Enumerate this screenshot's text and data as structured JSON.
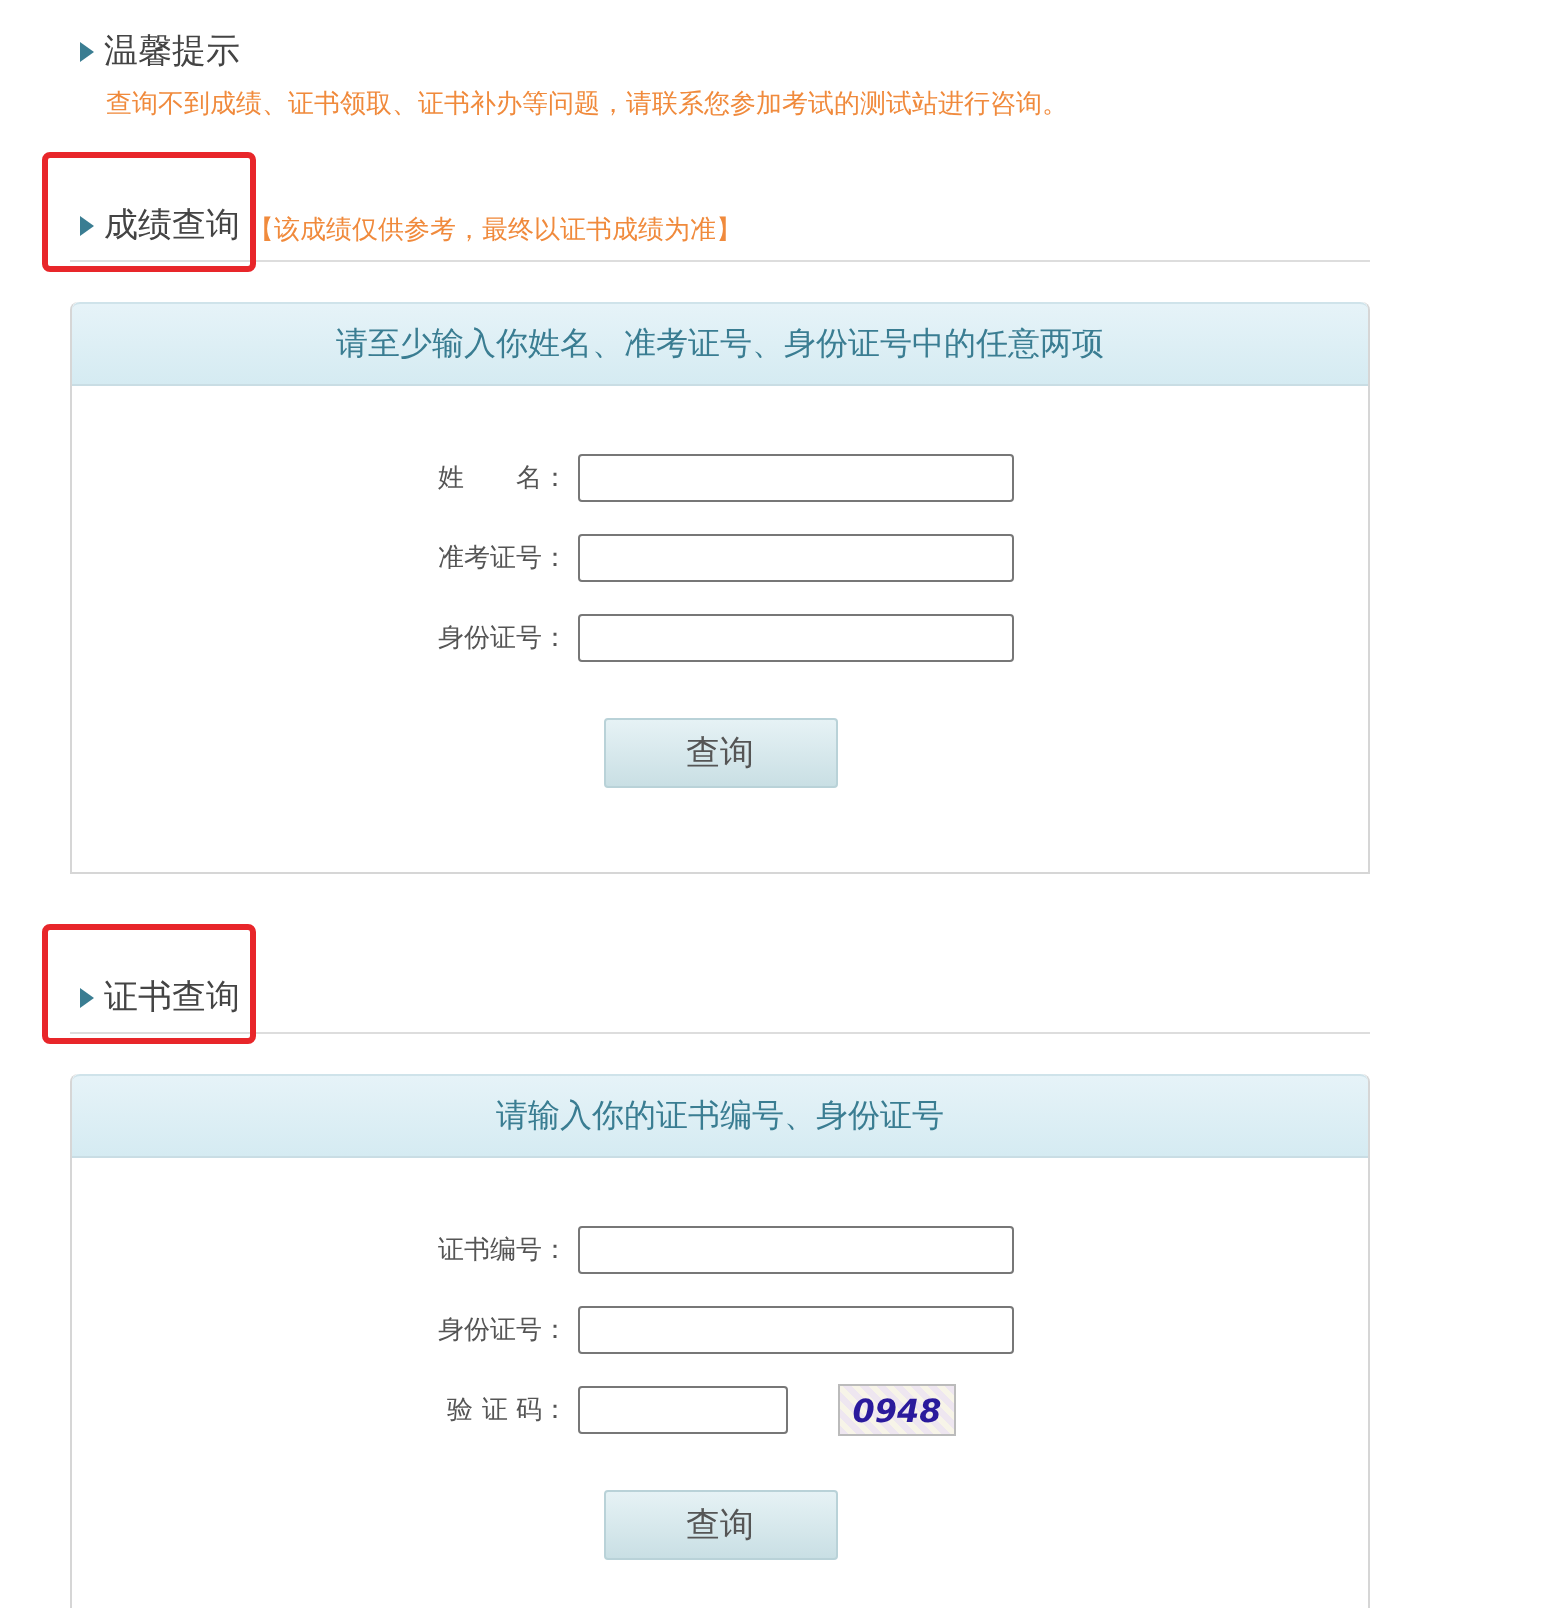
{
  "tip": {
    "title": "温馨提示",
    "text": "查询不到成绩、证书领取、证书补办等问题，请联系您参加考试的测试站进行咨询。"
  },
  "sections": [
    {
      "title": "成绩查询",
      "note": "【该成绩仅供参考，最终以证书成绩为准】",
      "highlighted": true,
      "card_title": "请至少输入你姓名、准考证号、身份证号中的任意两项",
      "fields": [
        {
          "kind": "text",
          "label": "姓　　名："
        },
        {
          "kind": "text",
          "label": "准考证号："
        },
        {
          "kind": "text",
          "label": "身份证号："
        }
      ],
      "button": "查询"
    },
    {
      "title": "证书查询",
      "highlighted": true,
      "card_title": "请输入你的证书编号、身份证号",
      "fields": [
        {
          "kind": "text",
          "label": "证书编号："
        },
        {
          "kind": "text",
          "label": "身份证号："
        },
        {
          "kind": "captcha",
          "label": "验 证 码：",
          "captcha": "0948"
        }
      ],
      "button": "查询"
    }
  ]
}
